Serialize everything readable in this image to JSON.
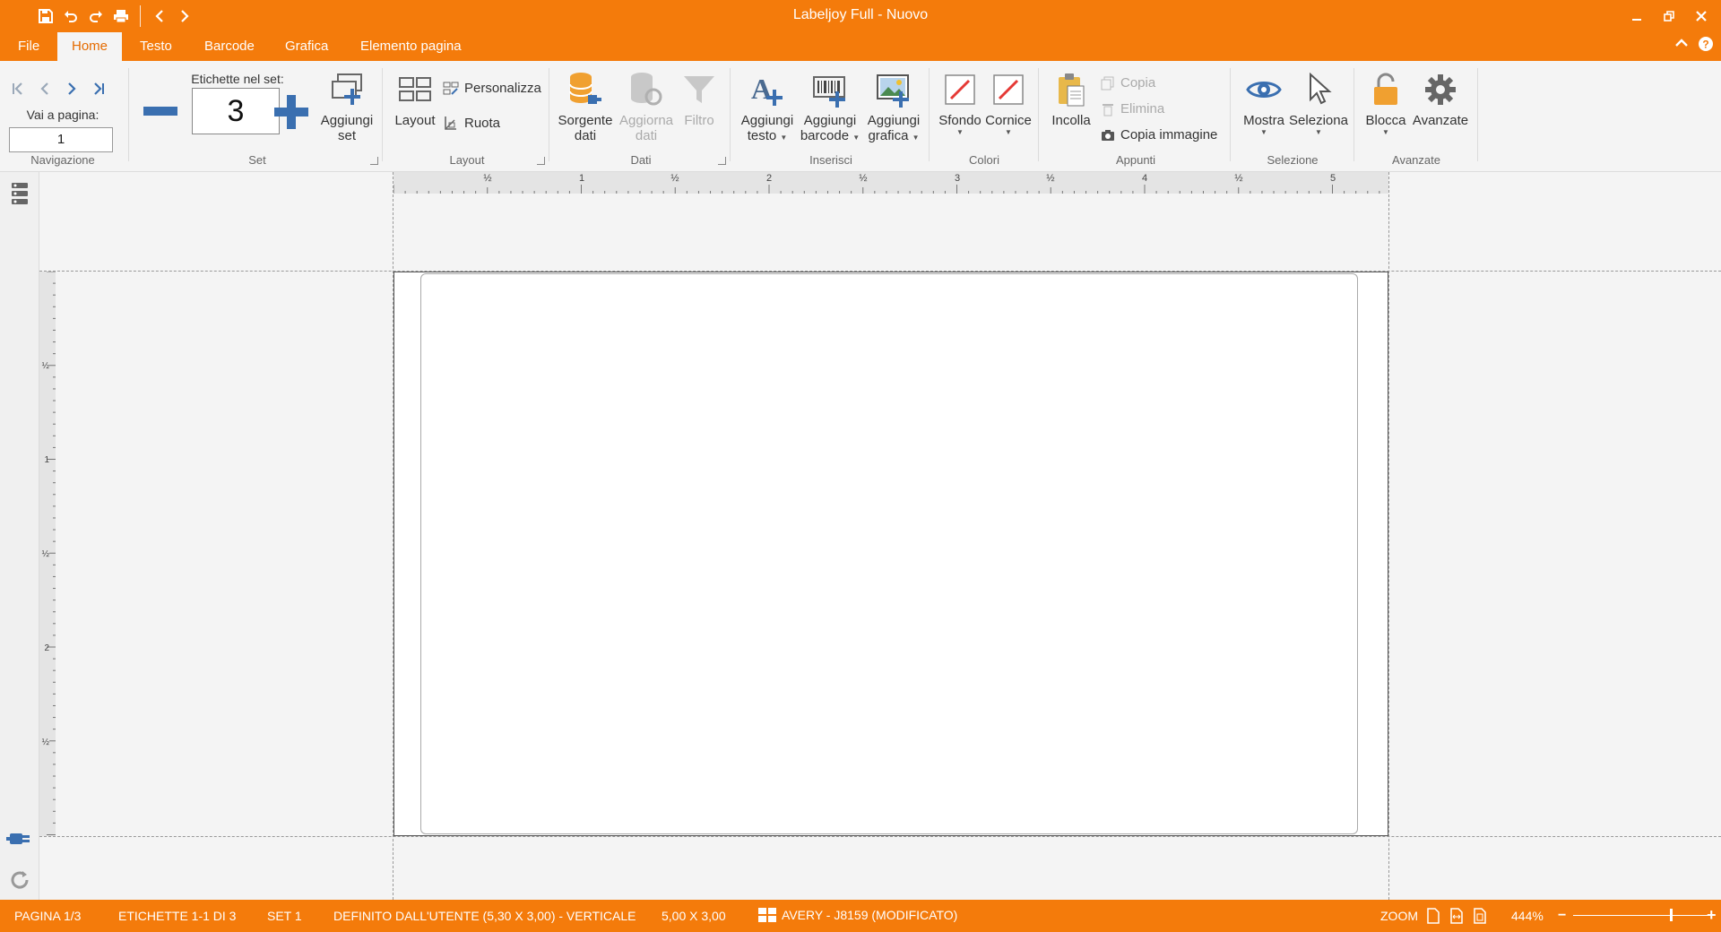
{
  "window": {
    "title": "Labeljoy Full - Nuovo"
  },
  "menu": {
    "tabs": [
      "File",
      "Home",
      "Testo",
      "Barcode",
      "Grafica",
      "Elemento pagina"
    ],
    "active": "Home"
  },
  "ribbon": {
    "navigazione": {
      "label": "Navigazione",
      "goto_label": "Vai a pagina:",
      "page_value": "1"
    },
    "set": {
      "label": "Set",
      "count_label": "Etichette nel set:",
      "count_value": "3",
      "add_set_line1": "Aggiungi",
      "add_set_line2": "set"
    },
    "layout": {
      "label": "Layout",
      "layout_btn": "Layout",
      "personalizza": "Personalizza",
      "ruota": "Ruota"
    },
    "dati": {
      "label": "Dati",
      "sorgente_line1": "Sorgente",
      "sorgente_line2": "dati",
      "aggiorna_line1": "Aggiorna",
      "aggiorna_line2": "dati",
      "filtro": "Filtro"
    },
    "inserisci": {
      "label": "Inserisci",
      "testo_line1": "Aggiungi",
      "testo_line2": "testo",
      "barcode_line1": "Aggiungi",
      "barcode_line2": "barcode",
      "grafica_line1": "Aggiungi",
      "grafica_line2": "grafica"
    },
    "colori": {
      "label": "Colori",
      "sfondo": "Sfondo",
      "cornice": "Cornice",
      "accent": "#e53935"
    },
    "appunti": {
      "label": "Appunti",
      "incolla": "Incolla",
      "copia": "Copia",
      "elimina": "Elimina",
      "copia_immagine": "Copia immagine"
    },
    "selezione": {
      "label": "Selezione",
      "mostra": "Mostra",
      "seleziona": "Seleziona"
    },
    "avanzate": {
      "label": "Avanzate",
      "blocca": "Blocca",
      "avanzate": "Avanzate"
    }
  },
  "rulers": {
    "horizontal_labels": [
      "½",
      "1",
      "½",
      "2",
      "½",
      "3",
      "½",
      "4",
      "½",
      "5"
    ],
    "vertical_labels": [
      "½",
      "1",
      "½",
      "2",
      "½"
    ]
  },
  "status": {
    "pagina": "PAGINA 1/3",
    "etichette": "ETICHETTE 1-1 DI 3",
    "set": "SET 1",
    "definito": "DEFINITO DALL'UTENTE (5,30 X 3,00) - VERTICALE",
    "dimensioni": "5,00 X 3,00",
    "avery": "AVERY - J8159 (MODIFICATO)",
    "zoom_label": "ZOOM",
    "zoom_value": "444%",
    "zoom_level_fraction": 0.72
  },
  "colors": {
    "brand": "#f47b0b",
    "ribbon_bg": "#f4f4f4",
    "icon_blue": "#3a6fb0",
    "icon_orange": "#f0a030"
  }
}
